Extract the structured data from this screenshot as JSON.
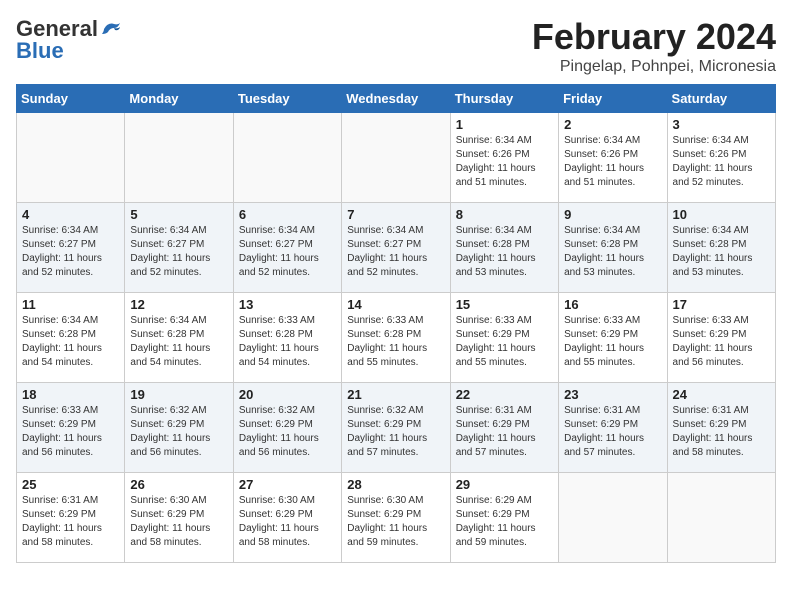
{
  "header": {
    "logo_general": "General",
    "logo_blue": "Blue",
    "title": "February 2024",
    "subtitle": "Pingelap, Pohnpei, Micronesia"
  },
  "days_of_week": [
    "Sunday",
    "Monday",
    "Tuesday",
    "Wednesday",
    "Thursday",
    "Friday",
    "Saturday"
  ],
  "weeks": [
    [
      {
        "day": "",
        "info": ""
      },
      {
        "day": "",
        "info": ""
      },
      {
        "day": "",
        "info": ""
      },
      {
        "day": "",
        "info": ""
      },
      {
        "day": "1",
        "info": "Sunrise: 6:34 AM\nSunset: 6:26 PM\nDaylight: 11 hours\nand 51 minutes."
      },
      {
        "day": "2",
        "info": "Sunrise: 6:34 AM\nSunset: 6:26 PM\nDaylight: 11 hours\nand 51 minutes."
      },
      {
        "day": "3",
        "info": "Sunrise: 6:34 AM\nSunset: 6:26 PM\nDaylight: 11 hours\nand 52 minutes."
      }
    ],
    [
      {
        "day": "4",
        "info": "Sunrise: 6:34 AM\nSunset: 6:27 PM\nDaylight: 11 hours\nand 52 minutes."
      },
      {
        "day": "5",
        "info": "Sunrise: 6:34 AM\nSunset: 6:27 PM\nDaylight: 11 hours\nand 52 minutes."
      },
      {
        "day": "6",
        "info": "Sunrise: 6:34 AM\nSunset: 6:27 PM\nDaylight: 11 hours\nand 52 minutes."
      },
      {
        "day": "7",
        "info": "Sunrise: 6:34 AM\nSunset: 6:27 PM\nDaylight: 11 hours\nand 52 minutes."
      },
      {
        "day": "8",
        "info": "Sunrise: 6:34 AM\nSunset: 6:28 PM\nDaylight: 11 hours\nand 53 minutes."
      },
      {
        "day": "9",
        "info": "Sunrise: 6:34 AM\nSunset: 6:28 PM\nDaylight: 11 hours\nand 53 minutes."
      },
      {
        "day": "10",
        "info": "Sunrise: 6:34 AM\nSunset: 6:28 PM\nDaylight: 11 hours\nand 53 minutes."
      }
    ],
    [
      {
        "day": "11",
        "info": "Sunrise: 6:34 AM\nSunset: 6:28 PM\nDaylight: 11 hours\nand 54 minutes."
      },
      {
        "day": "12",
        "info": "Sunrise: 6:34 AM\nSunset: 6:28 PM\nDaylight: 11 hours\nand 54 minutes."
      },
      {
        "day": "13",
        "info": "Sunrise: 6:33 AM\nSunset: 6:28 PM\nDaylight: 11 hours\nand 54 minutes."
      },
      {
        "day": "14",
        "info": "Sunrise: 6:33 AM\nSunset: 6:28 PM\nDaylight: 11 hours\nand 55 minutes."
      },
      {
        "day": "15",
        "info": "Sunrise: 6:33 AM\nSunset: 6:29 PM\nDaylight: 11 hours\nand 55 minutes."
      },
      {
        "day": "16",
        "info": "Sunrise: 6:33 AM\nSunset: 6:29 PM\nDaylight: 11 hours\nand 55 minutes."
      },
      {
        "day": "17",
        "info": "Sunrise: 6:33 AM\nSunset: 6:29 PM\nDaylight: 11 hours\nand 56 minutes."
      }
    ],
    [
      {
        "day": "18",
        "info": "Sunrise: 6:33 AM\nSunset: 6:29 PM\nDaylight: 11 hours\nand 56 minutes."
      },
      {
        "day": "19",
        "info": "Sunrise: 6:32 AM\nSunset: 6:29 PM\nDaylight: 11 hours\nand 56 minutes."
      },
      {
        "day": "20",
        "info": "Sunrise: 6:32 AM\nSunset: 6:29 PM\nDaylight: 11 hours\nand 56 minutes."
      },
      {
        "day": "21",
        "info": "Sunrise: 6:32 AM\nSunset: 6:29 PM\nDaylight: 11 hours\nand 57 minutes."
      },
      {
        "day": "22",
        "info": "Sunrise: 6:31 AM\nSunset: 6:29 PM\nDaylight: 11 hours\nand 57 minutes."
      },
      {
        "day": "23",
        "info": "Sunrise: 6:31 AM\nSunset: 6:29 PM\nDaylight: 11 hours\nand 57 minutes."
      },
      {
        "day": "24",
        "info": "Sunrise: 6:31 AM\nSunset: 6:29 PM\nDaylight: 11 hours\nand 58 minutes."
      }
    ],
    [
      {
        "day": "25",
        "info": "Sunrise: 6:31 AM\nSunset: 6:29 PM\nDaylight: 11 hours\nand 58 minutes."
      },
      {
        "day": "26",
        "info": "Sunrise: 6:30 AM\nSunset: 6:29 PM\nDaylight: 11 hours\nand 58 minutes."
      },
      {
        "day": "27",
        "info": "Sunrise: 6:30 AM\nSunset: 6:29 PM\nDaylight: 11 hours\nand 58 minutes."
      },
      {
        "day": "28",
        "info": "Sunrise: 6:30 AM\nSunset: 6:29 PM\nDaylight: 11 hours\nand 59 minutes."
      },
      {
        "day": "29",
        "info": "Sunrise: 6:29 AM\nSunset: 6:29 PM\nDaylight: 11 hours\nand 59 minutes."
      },
      {
        "day": "",
        "info": ""
      },
      {
        "day": "",
        "info": ""
      }
    ]
  ]
}
